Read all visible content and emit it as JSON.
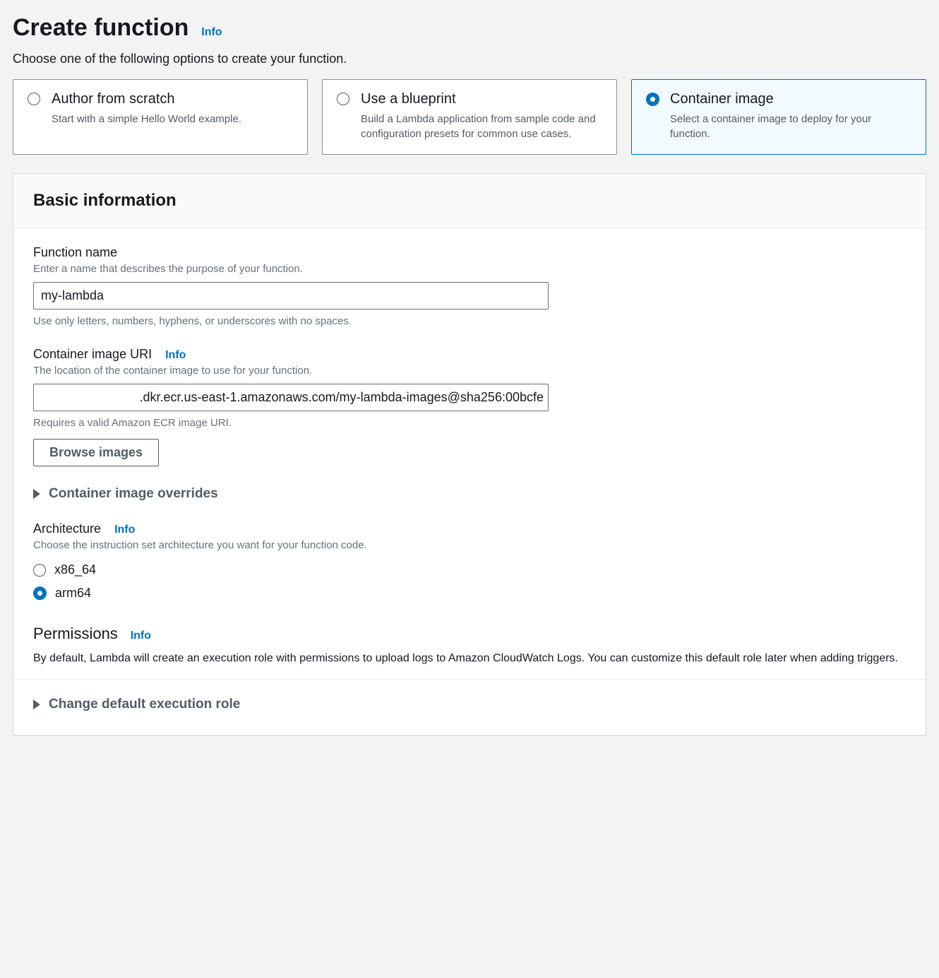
{
  "header": {
    "title": "Create function",
    "info": "Info",
    "subtitle": "Choose one of the following options to create your function."
  },
  "options": [
    {
      "title": "Author from scratch",
      "desc": "Start with a simple Hello World example.",
      "selected": false
    },
    {
      "title": "Use a blueprint",
      "desc": "Build a Lambda application from sample code and configuration presets for common use cases.",
      "selected": false
    },
    {
      "title": "Container image",
      "desc": "Select a container image to deploy for your function.",
      "selected": true
    }
  ],
  "basic": {
    "section_title": "Basic information",
    "function_name": {
      "label": "Function name",
      "desc": "Enter a name that describes the purpose of your function.",
      "value": "my-lambda",
      "help": "Use only letters, numbers, hyphens, or underscores with no spaces."
    },
    "container_uri": {
      "label": "Container image URI",
      "info": "Info",
      "desc": "The location of the container image to use for your function.",
      "value": ".dkr.ecr.us-east-1.amazonaws.com/my-lambda-images@sha256:00bcfe",
      "help": "Requires a valid Amazon ECR image URI.",
      "browse_button": "Browse images"
    },
    "overrides_section": "Container image overrides",
    "architecture": {
      "label": "Architecture",
      "info": "Info",
      "desc": "Choose the instruction set architecture you want for your function code.",
      "options": [
        "x86_64",
        "arm64"
      ],
      "selected": "arm64"
    },
    "permissions": {
      "title": "Permissions",
      "info": "Info",
      "desc": "By default, Lambda will create an execution role with permissions to upload logs to Amazon CloudWatch Logs. You can customize this default role later when adding triggers."
    },
    "change_role_section": "Change default execution role"
  }
}
